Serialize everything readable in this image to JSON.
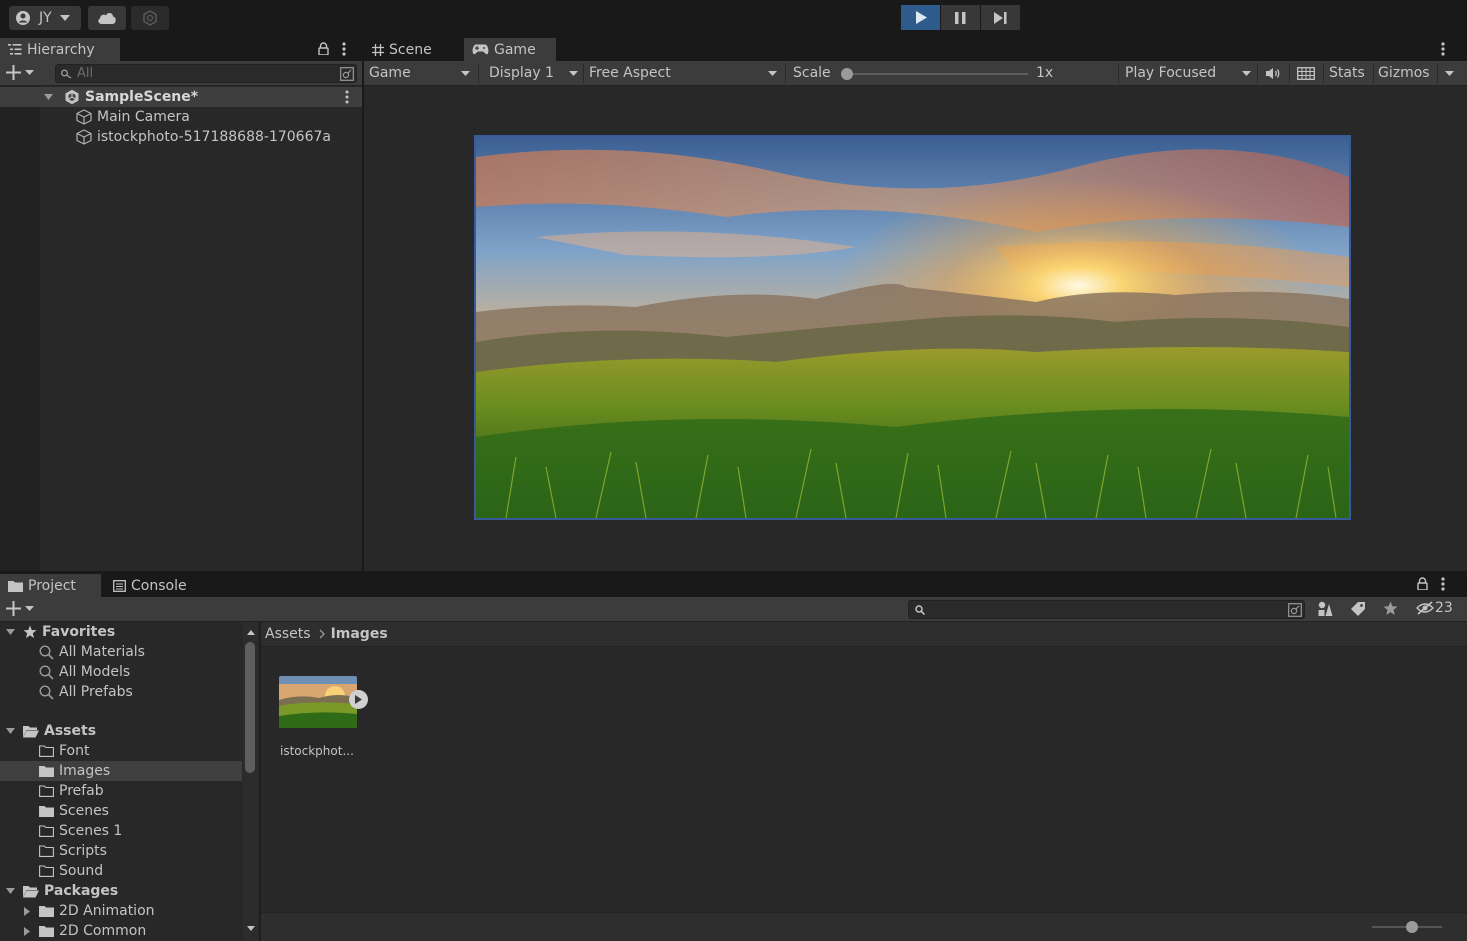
{
  "toolbar": {
    "account_label": "JY",
    "play_buttons": [
      "play-icon",
      "pause-icon",
      "step-icon"
    ]
  },
  "hierarchy": {
    "tab_label": "Hierarchy",
    "search_placeholder": "All",
    "scene_name": "SampleScene*",
    "items": [
      "Main Camera",
      "istockphoto-517188688-170667a"
    ]
  },
  "view_tabs": {
    "scene": "Scene",
    "game": "Game"
  },
  "game_toolbar": {
    "mode": "Game",
    "display": "Display 1",
    "aspect": "Free Aspect",
    "scale_label": "Scale",
    "scale_value": "1x",
    "play_mode": "Play Focused",
    "stats": "Stats",
    "gizmos": "Gizmos"
  },
  "game_view": {
    "image_description_icon": "landscape-sunset-image"
  },
  "bottom_tabs": {
    "project": "Project",
    "console": "Console"
  },
  "project": {
    "hidden_count": "23",
    "favorites": {
      "label": "Favorites",
      "items": [
        "All Materials",
        "All Models",
        "All Prefabs"
      ]
    },
    "assets": {
      "label": "Assets",
      "items": [
        "Font",
        "Images",
        "Prefab",
        "Scenes",
        "Scenes 1",
        "Scripts",
        "Sound"
      ],
      "selected": "Images"
    },
    "packages": {
      "label": "Packages",
      "items": [
        "2D Animation",
        "2D Common"
      ]
    },
    "breadcrumb": [
      "Assets",
      "Images"
    ],
    "files": [
      {
        "name": "istockphot..."
      }
    ]
  },
  "colors": {
    "background": "#191919",
    "panel": "#282828",
    "toolbar": "#3c3c3c",
    "play_active": "#2f5a8c",
    "selection": "#3f3f3f",
    "text": "#c4c4c4"
  }
}
